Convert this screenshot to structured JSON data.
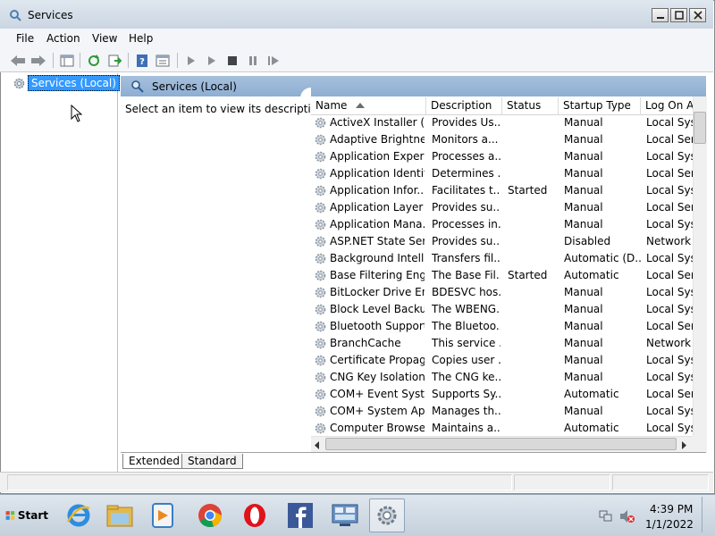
{
  "window": {
    "title": "Services"
  },
  "menu": [
    "File",
    "Action",
    "View",
    "Help"
  ],
  "tree": {
    "item": "Services (Local)"
  },
  "panel": {
    "title": "Services (Local)",
    "description_prompt": "Select an item to view its description."
  },
  "columns": [
    "Name",
    "Description",
    "Status",
    "Startup Type",
    "Log On A"
  ],
  "rows": [
    {
      "name": "ActiveX Installer (...",
      "desc": "Provides Us...",
      "status": "",
      "startup": "Manual",
      "logon": "Local Syst"
    },
    {
      "name": "Adaptive Brightness",
      "desc": "Monitors a...",
      "status": "",
      "startup": "Manual",
      "logon": "Local Serv"
    },
    {
      "name": "Application Experi...",
      "desc": "Processes a...",
      "status": "",
      "startup": "Manual",
      "logon": "Local Syst"
    },
    {
      "name": "Application Identity",
      "desc": "Determines ...",
      "status": "",
      "startup": "Manual",
      "logon": "Local Serv"
    },
    {
      "name": "Application Infor...",
      "desc": "Facilitates t...",
      "status": "Started",
      "startup": "Manual",
      "logon": "Local Syst"
    },
    {
      "name": "Application Layer ...",
      "desc": "Provides su...",
      "status": "",
      "startup": "Manual",
      "logon": "Local Serv"
    },
    {
      "name": "Application Mana...",
      "desc": "Processes in...",
      "status": "",
      "startup": "Manual",
      "logon": "Local Syst"
    },
    {
      "name": "ASP.NET State Ser...",
      "desc": "Provides su...",
      "status": "",
      "startup": "Disabled",
      "logon": "Network S"
    },
    {
      "name": "Background Intelli...",
      "desc": "Transfers fil...",
      "status": "",
      "startup": "Automatic (D...",
      "logon": "Local Syst"
    },
    {
      "name": "Base Filtering Engi...",
      "desc": "The Base Fil...",
      "status": "Started",
      "startup": "Automatic",
      "logon": "Local Serv"
    },
    {
      "name": "BitLocker Drive En...",
      "desc": "BDESVC hos...",
      "status": "",
      "startup": "Manual",
      "logon": "Local Syst"
    },
    {
      "name": "Block Level Backu...",
      "desc": "The WBENG...",
      "status": "",
      "startup": "Manual",
      "logon": "Local Syst"
    },
    {
      "name": "Bluetooth Support...",
      "desc": "The Bluetoo...",
      "status": "",
      "startup": "Manual",
      "logon": "Local Serv"
    },
    {
      "name": "BranchCache",
      "desc": "This service ...",
      "status": "",
      "startup": "Manual",
      "logon": "Network S"
    },
    {
      "name": "Certificate Propag...",
      "desc": "Copies user ...",
      "status": "",
      "startup": "Manual",
      "logon": "Local Syst"
    },
    {
      "name": "CNG Key Isolation",
      "desc": "The CNG ke...",
      "status": "",
      "startup": "Manual",
      "logon": "Local Syst"
    },
    {
      "name": "COM+ Event Syst...",
      "desc": "Supports Sy...",
      "status": "",
      "startup": "Automatic",
      "logon": "Local Serv"
    },
    {
      "name": "COM+ System Ap...",
      "desc": "Manages th...",
      "status": "",
      "startup": "Manual",
      "logon": "Local Syst"
    },
    {
      "name": "Computer Browser",
      "desc": "Maintains a...",
      "status": "",
      "startup": "Automatic",
      "logon": "Local Syst"
    }
  ],
  "tabs": [
    "Extended",
    "Standard"
  ],
  "taskbar": {
    "start_label": "Start",
    "apps": [
      "internet-explorer-icon",
      "file-explorer-icon",
      "media-player-icon",
      "chrome-icon",
      "opera-icon",
      "facebook-icon",
      "control-panel-icon",
      "services-icon"
    ],
    "time": "4:39 PM",
    "date": "1/1/2022"
  },
  "colors": {
    "selection": "#3399ff",
    "panel_header": "#9db9d9",
    "taskbar": "#d3dde8"
  }
}
